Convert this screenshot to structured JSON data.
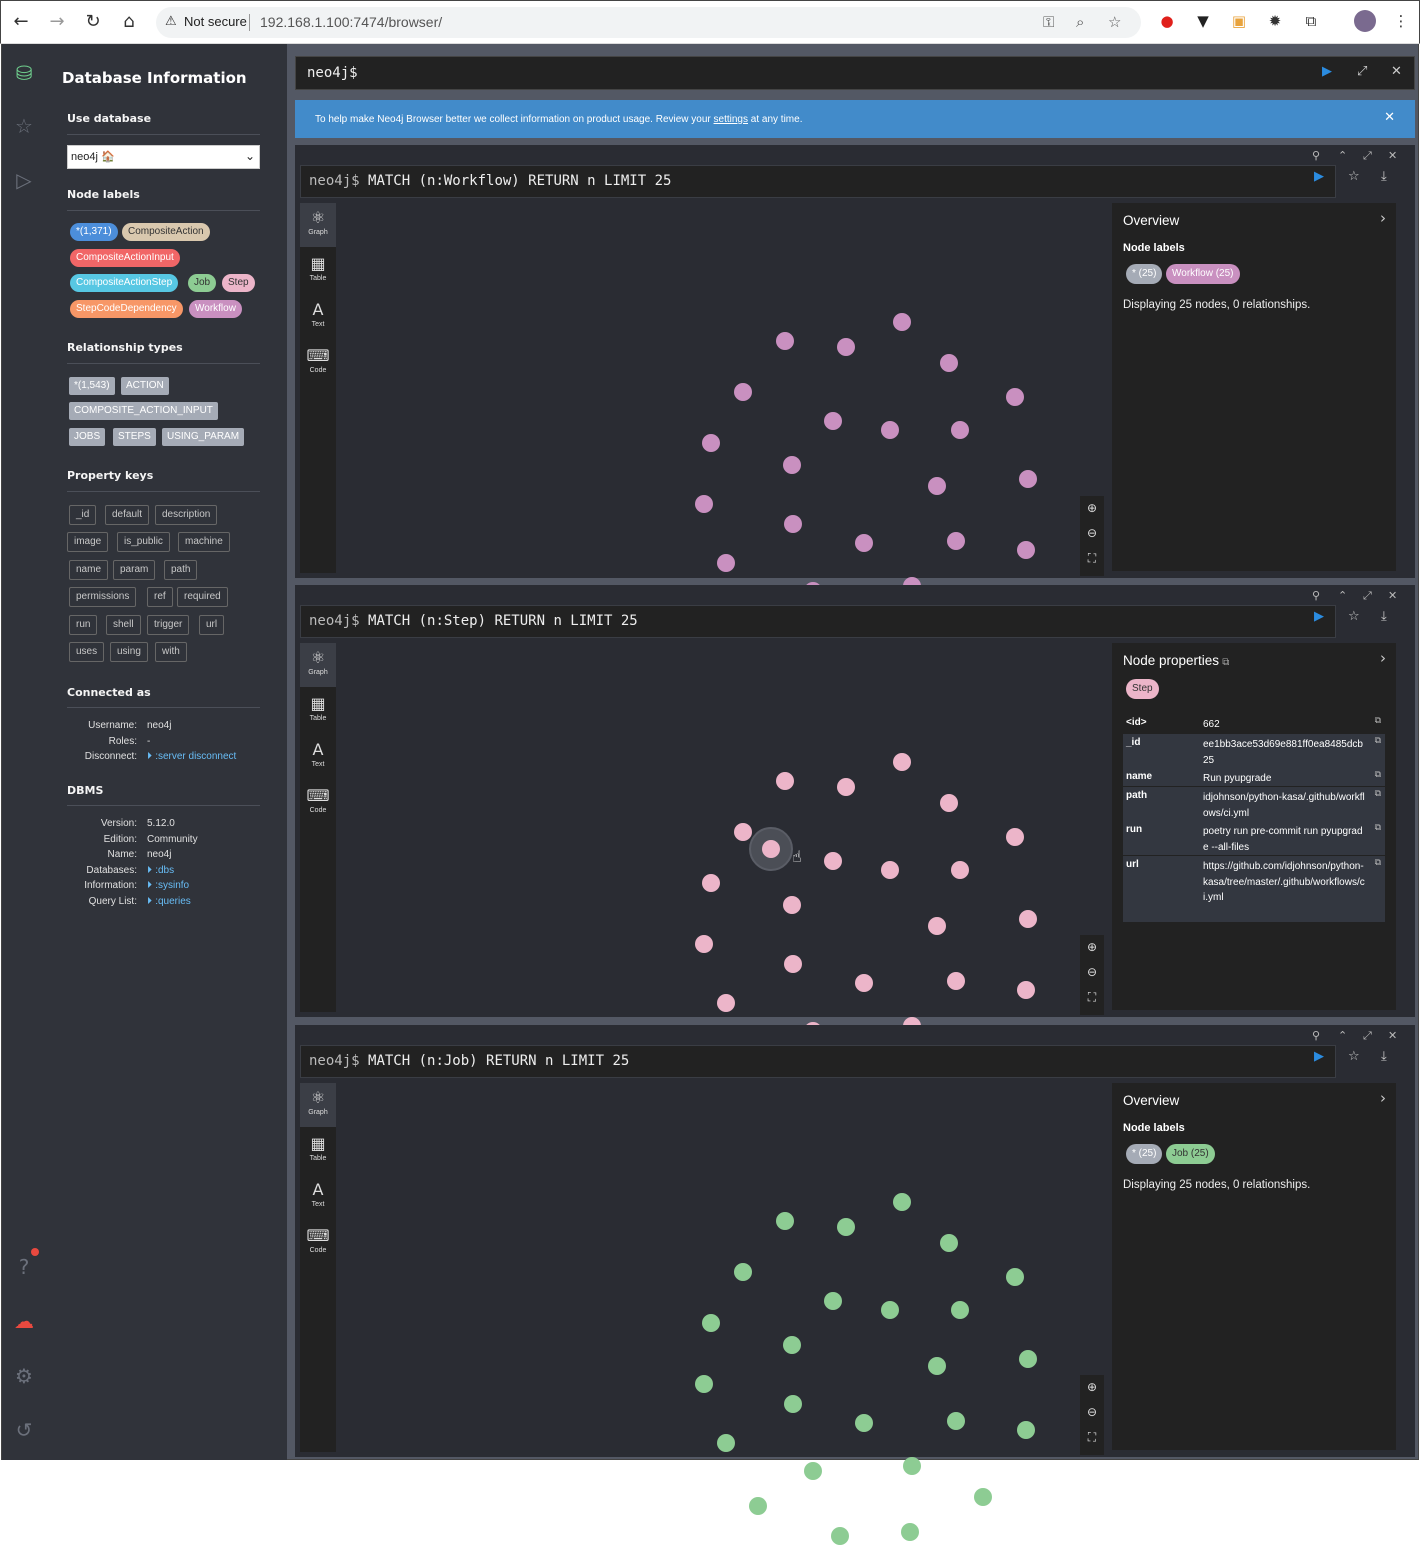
{
  "browser": {
    "security": "Not secure",
    "url": "192.168.1.100:7474/browser/"
  },
  "drawer": {
    "title": "Database Information",
    "use_database_label": "Use database",
    "database": "neo4j 🏠",
    "node_labels_title": "Node labels",
    "node_labels": [
      {
        "label": "*(1,371)",
        "color": "#4c8eda"
      },
      {
        "label": "CompositeAction",
        "color": "#d9c8ae"
      },
      {
        "label": "CompositeActionInput",
        "color": "#f16667"
      },
      {
        "label": "CompositeActionStep",
        "color": "#57c7e3"
      },
      {
        "label": "Job",
        "color": "#8dcc93"
      },
      {
        "label": "Step",
        "color": "#ecb5c9"
      },
      {
        "label": "StepCodeDependency",
        "color": "#f79767"
      },
      {
        "label": "Workflow",
        "color": "#c990c0"
      }
    ],
    "relationship_types_title": "Relationship types",
    "relationship_types": [
      "*(1,543)",
      "ACTION",
      "COMPOSITE_ACTION_INPUT",
      "JOBS",
      "STEPS",
      "USING_PARAM"
    ],
    "property_keys_title": "Property keys",
    "property_keys": [
      "_id",
      "default",
      "description",
      "image",
      "is_public",
      "machine",
      "name",
      "param",
      "path",
      "permissions",
      "ref",
      "required",
      "run",
      "shell",
      "trigger",
      "url",
      "uses",
      "using",
      "with"
    ],
    "connected_title": "Connected as",
    "connected": [
      {
        "k": "Username:",
        "v": "neo4j"
      },
      {
        "k": "Roles:",
        "v": "-"
      },
      {
        "k": "Disconnect:",
        "v": ":server disconnect"
      }
    ],
    "dbms_title": "DBMS",
    "dbms": [
      {
        "k": "Version:",
        "v": "5.12.0"
      },
      {
        "k": "Edition:",
        "v": "Community"
      },
      {
        "k": "Name:",
        "v": "neo4j"
      },
      {
        "k": "Databases:",
        "v": ":dbs"
      },
      {
        "k": "Information:",
        "v": ":sysinfo"
      },
      {
        "k": "Query List:",
        "v": ":queries"
      }
    ]
  },
  "editor": {
    "prompt": "neo4j$"
  },
  "banner": {
    "text_before": "To help make Neo4j Browser better we collect information on product usage. Review your ",
    "link": "settings",
    "text_after": " at any time."
  },
  "tabs": {
    "graph": "Graph",
    "table": "Table",
    "text": "Text",
    "code": "Code"
  },
  "frames": [
    {
      "prompt": "neo4j$",
      "query": "MATCH (n:Workflow) RETURN n LIMIT 25",
      "node_color": "#c990c0",
      "side": {
        "title": "Overview",
        "subtitle": "Node labels",
        "chips": [
          {
            "label": "* (25)",
            "color": "#a5abb6",
            "text": "#fff"
          },
          {
            "label": "Workflow (25)",
            "color": "#c990c0",
            "text": "#fff"
          }
        ],
        "display": "Displaying 25 nodes, 0 relationships."
      }
    },
    {
      "prompt": "neo4j$",
      "query": "MATCH (n:Step) RETURN n LIMIT 25",
      "node_color": "#ecb5c9",
      "side": {
        "title": "Node properties",
        "chip": {
          "label": "Step",
          "color": "#ecb5c9",
          "text": "#333"
        },
        "props": [
          {
            "k": "<id>",
            "v": "662"
          },
          {
            "k": "_id",
            "v": "ee1bb3ace53d69e881ff0ea8485dcb25"
          },
          {
            "k": "name",
            "v": "Run pyupgrade"
          },
          {
            "k": "path",
            "v": "idjohnson/python-kasa/.github/workflows/ci.yml"
          },
          {
            "k": "run",
            "v": "poetry run pre-commit run pyupgrade --all-files"
          },
          {
            "k": "url",
            "v": "https://github.com/idjohnson/python-kasa/tree/master/.github/workflows/ci.yml"
          }
        ]
      }
    },
    {
      "prompt": "neo4j$",
      "query": "MATCH (n:Job) RETURN n LIMIT 25",
      "node_color": "#8dcc93",
      "side": {
        "title": "Overview",
        "subtitle": "Node labels",
        "chips": [
          {
            "label": "* (25)",
            "color": "#a5abb6",
            "text": "#fff"
          },
          {
            "label": "Job (25)",
            "color": "#8dcc93",
            "text": "#333"
          }
        ],
        "display": "Displaying 25 nodes, 0 relationships."
      }
    }
  ]
}
